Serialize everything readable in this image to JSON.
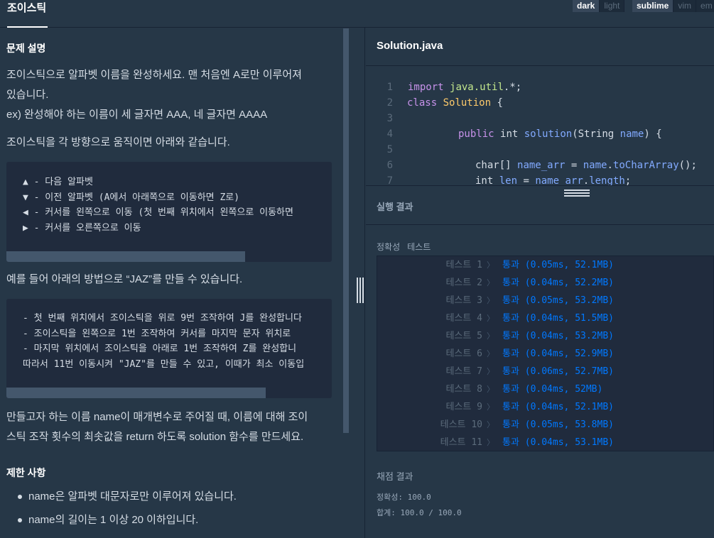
{
  "header": {
    "title": "조이스틱",
    "theme_toggle": [
      "dark",
      "light"
    ],
    "keymap_toggle": [
      "sublime",
      "vim",
      "em"
    ]
  },
  "problem": {
    "section_title": "문제 설명",
    "intro_line1": "조이스틱으로 알파벳 이름을 완성하세요. 맨 처음엔 A로만 이루어져",
    "intro_line2": "있습니다.",
    "intro_line3": "ex) 완성해야 하는 이름이 세 글자면 AAA, 네 글자면 AAAA",
    "move_intro": "조이스틱을 각 방향으로 움직이면 아래와 같습니다.",
    "moves": [
      "▲ - 다음 알파벳",
      "▼ - 이전 알파벳 (A에서 아래쪽으로 이동하면 Z로)",
      "◀ - 커서를 왼쪽으로 이동 (첫 번째 위치에서 왼쪽으로 이동하면",
      "▶ - 커서를 오른쪽으로 이동"
    ],
    "example_intro": "예를 들어 아래의 방법으로 “JAZ”를 만들 수 있습니다.",
    "example_lines": [
      "- 첫 번째 위치에서 조이스틱을 위로 9번 조작하여 J를 완성합니다",
      "- 조이스틱을 왼쪽으로 1번 조작하여 커서를 마지막 문자 위치로",
      "- 마지막 위치에서 조이스틱을 아래로 1번 조작하여 Z를 완성합니",
      "따라서 11번 이동시켜 \"JAZ\"를 만들 수 있고, 이때가 최소 이동입"
    ],
    "task_line1": "만들고자 하는 이름 name이 매개변수로 주어질 때, 이름에 대해 조이",
    "task_line2": "스틱 조작 횟수의 최솟값을 return 하도록 solution 함수를 만드세요.",
    "limits_title": "제한 사항",
    "limits": [
      "name은 알파벳 대문자로만 이루어져 있습니다.",
      "name의 길이는 1 이상 20 이하입니다."
    ]
  },
  "editor": {
    "file_name": "Solution.java",
    "line_numbers": [
      "1",
      "2",
      "3",
      "4",
      "5",
      "6",
      "7"
    ]
  },
  "run": {
    "title": "실행 결과",
    "tab_accuracy": "정확성",
    "tab_test": "테스트",
    "tests": [
      {
        "name": "테스트 1",
        "status": "통과",
        "detail": "(0.05ms, 52.1MB)"
      },
      {
        "name": "테스트 2",
        "status": "통과",
        "detail": "(0.04ms, 52.2MB)"
      },
      {
        "name": "테스트 3",
        "status": "통과",
        "detail": "(0.05ms, 53.2MB)"
      },
      {
        "name": "테스트 4",
        "status": "통과",
        "detail": "(0.04ms, 51.5MB)"
      },
      {
        "name": "테스트 5",
        "status": "통과",
        "detail": "(0.04ms, 53.2MB)"
      },
      {
        "name": "테스트 6",
        "status": "통과",
        "detail": "(0.04ms, 52.9MB)"
      },
      {
        "name": "테스트 7",
        "status": "통과",
        "detail": "(0.06ms, 52.7MB)"
      },
      {
        "name": "테스트 8",
        "status": "통과",
        "detail": "(0.04ms, 52MB)"
      },
      {
        "name": "테스트 9",
        "status": "통과",
        "detail": "(0.04ms, 52.1MB)"
      },
      {
        "name": "테스트 10",
        "status": "통과",
        "detail": "(0.05ms, 53.8MB)"
      },
      {
        "name": "테스트 11",
        "status": "통과",
        "detail": "(0.04ms, 53.1MB)"
      }
    ],
    "grade_title": "채점 결과",
    "accuracy_line": "정확성: 100.0",
    "total_line": "합계: 100.0 / 100.0"
  },
  "colors": {
    "background": "#263747",
    "code_background": "#202b3d",
    "pass": "#0078ff"
  }
}
